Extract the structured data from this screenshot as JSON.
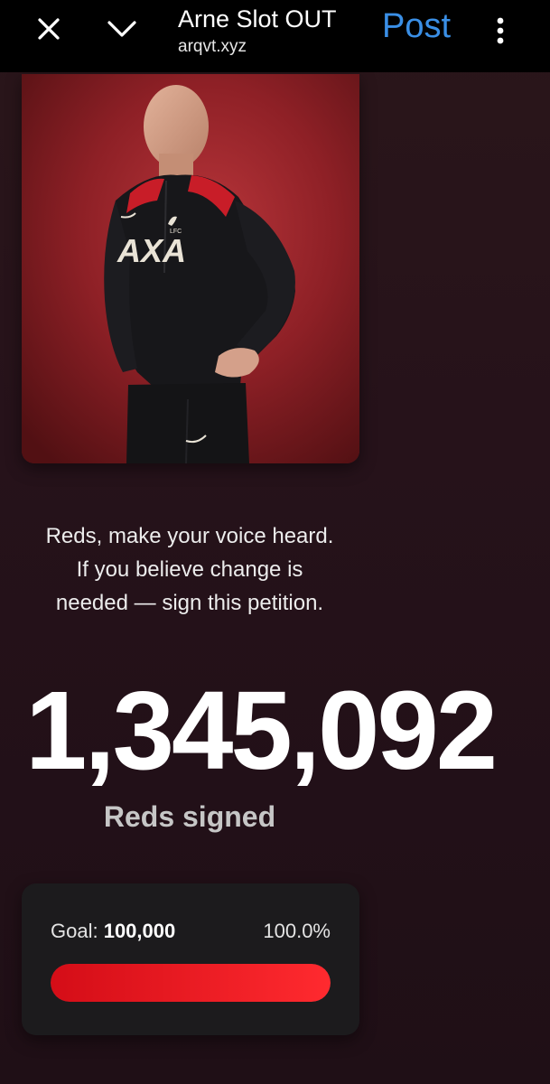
{
  "browser": {
    "title": "Arne Slot OUT",
    "domain": "arqvt.xyz",
    "post_label": "Post"
  },
  "hero_image": {
    "logo_text": "AXA",
    "crest_text": "LFC"
  },
  "message": {
    "line1": "Reds, make your voice heard.",
    "line2": "If you believe change is",
    "line3": "needed — sign this petition."
  },
  "counter": {
    "value": "1,345,092",
    "label": "Reds signed"
  },
  "goal": {
    "prefix": "Goal:",
    "amount": "100,000",
    "percent": "100.0%",
    "progress": 1.0
  },
  "colors": {
    "accent": "#3a8fe6",
    "progress": "#e8141c",
    "background": "#26121a"
  }
}
